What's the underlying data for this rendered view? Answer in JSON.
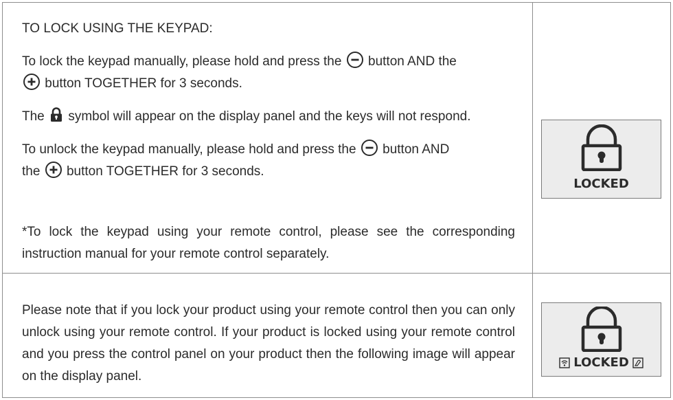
{
  "section1": {
    "heading": "TO LOCK USING THE KEYPAD:",
    "lock_p1_a": "To lock the keypad manually, please hold and press the",
    "lock_p1_b": "button AND the",
    "lock_p1_c": "button TOGETHER for 3 seconds.",
    "symbol_p_a": "The",
    "symbol_p_b": "symbol will appear on the display panel and the keys will not respond.",
    "unlock_p_a": "To unlock the keypad manually, please hold and press the",
    "unlock_p_b": "button AND",
    "unlock_p_c": "the",
    "unlock_p_d": "button TOGETHER for 3 seconds.",
    "note": "*To lock the keypad using your remote control, please see the corresponding instruction manual for your remote control separately.",
    "panel_label": "LOCKED"
  },
  "section2": {
    "paragraph": "Please note that if you lock your product using your remote control then you can only unlock using your remote control. If your product is locked using your remote control and you press the control panel on your product then the following image will appear on the display panel.",
    "panel_label": "LOCKED"
  },
  "icons": {
    "minus": "minus-circle-icon",
    "plus": "plus-circle-icon",
    "lock": "padlock-icon",
    "remote_left": "remote-signal-icon",
    "remote_right": "remote-hand-icon"
  }
}
